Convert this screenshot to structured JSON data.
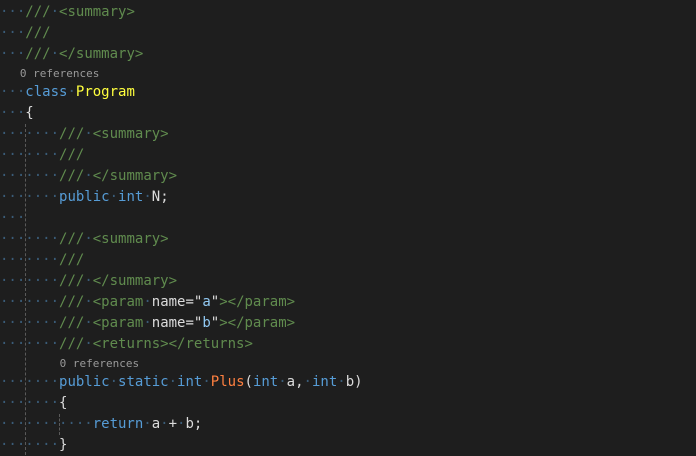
{
  "lines": [
    {
      "kind": "code",
      "indent": 0,
      "tokens": [
        {
          "t": "///",
          "c": "doctag"
        },
        {
          "t": " ",
          "c": "ws"
        },
        {
          "t": "<summary>",
          "c": "doctag"
        }
      ]
    },
    {
      "kind": "code",
      "indent": 0,
      "tokens": [
        {
          "t": "///",
          "c": "doctag"
        }
      ]
    },
    {
      "kind": "code",
      "indent": 0,
      "tokens": [
        {
          "t": "///",
          "c": "doctag"
        },
        {
          "t": " ",
          "c": "ws"
        },
        {
          "t": "</summary>",
          "c": "doctag"
        }
      ]
    },
    {
      "kind": "lens",
      "indent": 0,
      "text": "0 references"
    },
    {
      "kind": "code",
      "indent": 0,
      "tokens": [
        {
          "t": "class",
          "c": "kw"
        },
        {
          "t": " ",
          "c": "ws"
        },
        {
          "t": "Program",
          "c": "class"
        }
      ]
    },
    {
      "kind": "code",
      "indent": 0,
      "tokens": [
        {
          "t": "{",
          "c": "punct"
        }
      ]
    },
    {
      "kind": "code",
      "indent": 1,
      "tokens": [
        {
          "t": "///",
          "c": "doctag"
        },
        {
          "t": " ",
          "c": "ws"
        },
        {
          "t": "<summary>",
          "c": "doctag"
        }
      ]
    },
    {
      "kind": "code",
      "indent": 1,
      "tokens": [
        {
          "t": "///",
          "c": "doctag"
        }
      ]
    },
    {
      "kind": "code",
      "indent": 1,
      "tokens": [
        {
          "t": "///",
          "c": "doctag"
        },
        {
          "t": " ",
          "c": "ws"
        },
        {
          "t": "</summary>",
          "c": "doctag"
        }
      ]
    },
    {
      "kind": "code",
      "indent": 1,
      "tokens": [
        {
          "t": "public",
          "c": "kw"
        },
        {
          "t": " ",
          "c": "ws"
        },
        {
          "t": "int",
          "c": "kw"
        },
        {
          "t": " ",
          "c": "ws"
        },
        {
          "t": "N;",
          "c": "ident"
        }
      ]
    },
    {
      "kind": "code",
      "indent": 0,
      "tokens": []
    },
    {
      "kind": "code",
      "indent": 1,
      "tokens": [
        {
          "t": "///",
          "c": "doctag"
        },
        {
          "t": " ",
          "c": "ws"
        },
        {
          "t": "<summary>",
          "c": "doctag"
        }
      ]
    },
    {
      "kind": "code",
      "indent": 1,
      "tokens": [
        {
          "t": "///",
          "c": "doctag"
        }
      ]
    },
    {
      "kind": "code",
      "indent": 1,
      "tokens": [
        {
          "t": "///",
          "c": "doctag"
        },
        {
          "t": " ",
          "c": "ws"
        },
        {
          "t": "</summary>",
          "c": "doctag"
        }
      ]
    },
    {
      "kind": "code",
      "indent": 1,
      "tokens": [
        {
          "t": "///",
          "c": "doctag"
        },
        {
          "t": " ",
          "c": "ws"
        },
        {
          "t": "<param",
          "c": "doctag"
        },
        {
          "t": " ",
          "c": "ws"
        },
        {
          "t": "name=\"",
          "c": "ident"
        },
        {
          "t": "a",
          "c": "attr"
        },
        {
          "t": "\"",
          "c": "ident"
        },
        {
          "t": "></param>",
          "c": "doctag"
        }
      ]
    },
    {
      "kind": "code",
      "indent": 1,
      "tokens": [
        {
          "t": "///",
          "c": "doctag"
        },
        {
          "t": " ",
          "c": "ws"
        },
        {
          "t": "<param",
          "c": "doctag"
        },
        {
          "t": " ",
          "c": "ws"
        },
        {
          "t": "name=\"",
          "c": "ident"
        },
        {
          "t": "b",
          "c": "attr"
        },
        {
          "t": "\"",
          "c": "ident"
        },
        {
          "t": "></param>",
          "c": "doctag"
        }
      ]
    },
    {
      "kind": "code",
      "indent": 1,
      "tokens": [
        {
          "t": "///",
          "c": "doctag"
        },
        {
          "t": " ",
          "c": "ws"
        },
        {
          "t": "<returns></returns>",
          "c": "doctag"
        }
      ]
    },
    {
      "kind": "lens",
      "indent": 1,
      "text": "0 references"
    },
    {
      "kind": "code",
      "indent": 1,
      "tokens": [
        {
          "t": "public",
          "c": "kw"
        },
        {
          "t": " ",
          "c": "ws"
        },
        {
          "t": "static",
          "c": "kw"
        },
        {
          "t": " ",
          "c": "ws"
        },
        {
          "t": "int",
          "c": "kw"
        },
        {
          "t": " ",
          "c": "ws"
        },
        {
          "t": "Plus",
          "c": "method"
        },
        {
          "t": "(",
          "c": "punct"
        },
        {
          "t": "int",
          "c": "kw"
        },
        {
          "t": " ",
          "c": "ws"
        },
        {
          "t": "a,",
          "c": "ident"
        },
        {
          "t": " ",
          "c": "ws"
        },
        {
          "t": "int",
          "c": "kw"
        },
        {
          "t": " ",
          "c": "ws"
        },
        {
          "t": "b)",
          "c": "ident"
        }
      ]
    },
    {
      "kind": "code",
      "indent": 1,
      "tokens": [
        {
          "t": "{",
          "c": "punct"
        }
      ]
    },
    {
      "kind": "code",
      "indent": 2,
      "tokens": [
        {
          "t": "return",
          "c": "kw"
        },
        {
          "t": " ",
          "c": "ws"
        },
        {
          "t": "a",
          "c": "ident"
        },
        {
          "t": " ",
          "c": "ws"
        },
        {
          "t": "+",
          "c": "punct"
        },
        {
          "t": " ",
          "c": "ws"
        },
        {
          "t": "b;",
          "c": "ident"
        }
      ]
    },
    {
      "kind": "code",
      "indent": 1,
      "tokens": [
        {
          "t": "}",
          "c": "punct"
        }
      ]
    }
  ]
}
